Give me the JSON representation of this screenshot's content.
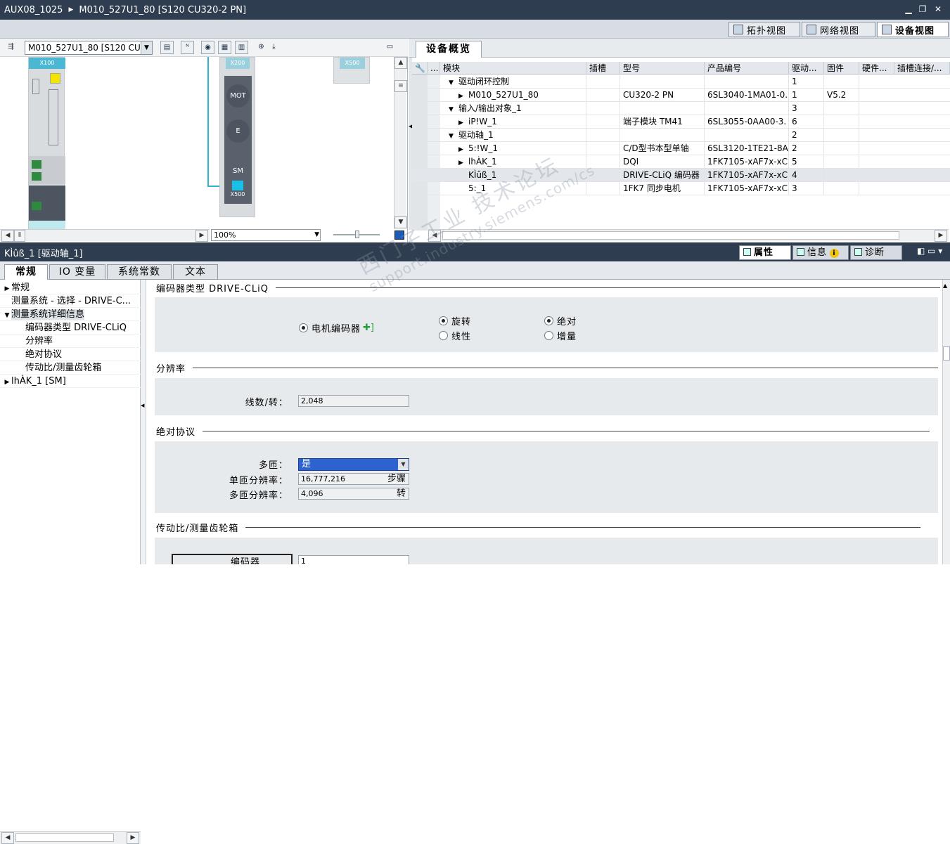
{
  "title": {
    "project": "AUX08_1025",
    "device": "M010_527U1_80 [S120 CU320-2 PN]",
    "win_min": "▁",
    "win_restore": "❐",
    "win_close": "✕"
  },
  "view_tabs": [
    {
      "label": "拓扑视图"
    },
    {
      "label": "网络视图"
    },
    {
      "label": "设备视图"
    }
  ],
  "device_view": {
    "device_select": "M010_527U1_80 [S120 CU",
    "zoom": "100%",
    "ports": {
      "x100": "X100",
      "x200": "X200",
      "x500a": "X500",
      "x500b": "X500"
    },
    "circles": {
      "mot": "MOT",
      "e": "E",
      "sm": "SM"
    }
  },
  "overview": {
    "tab": "设备概览",
    "headers": [
      "模块",
      "插槽",
      "型号",
      "产品编号",
      "驱动...",
      "固件",
      "硬件...",
      "插槽连接/..."
    ],
    "header_extra": "...",
    "rows": [
      {
        "expander": "▼",
        "module": "驱动闭环控制",
        "slot": "",
        "type": "",
        "order": "",
        "drive": "1",
        "fw": ""
      },
      {
        "expander": "▶",
        "module": "M010_527U1_80",
        "slot": "",
        "type": "CU320-2 PN",
        "order": "6SL3040-1MA01-0.",
        "drive": "1",
        "fw": "V5.2"
      },
      {
        "expander": "▼",
        "module": "输入/输出对象_1",
        "slot": "",
        "type": "",
        "order": "",
        "drive": "3",
        "fw": ""
      },
      {
        "expander": "▶",
        "module": "iP!W_1",
        "slot": "",
        "type": "端子模块 TM41",
        "order": "6SL3055-0AA00-3.",
        "drive": "6",
        "fw": ""
      },
      {
        "expander": "▼",
        "module": "驱动轴_1",
        "slot": "",
        "type": "",
        "order": "",
        "drive": "2",
        "fw": ""
      },
      {
        "expander": "▶",
        "module": "5:!W_1",
        "slot": "",
        "type": "C/D型书本型单轴",
        "order": "6SL3120-1TE21-8A",
        "drive": "2",
        "fw": ""
      },
      {
        "expander": "▶",
        "module": "lhÀK_1",
        "slot": "",
        "type": "DQI",
        "order": "1FK7105-xAF7x-xC.",
        "drive": "5",
        "fw": ""
      },
      {
        "expander": "",
        "module": "KÌûß_1",
        "slot": "",
        "type": "DRIVE-CLiQ 编码器",
        "order": "1FK7105-xAF7x-xC.",
        "drive": "4",
        "fw": ""
      },
      {
        "expander": "",
        "module": "5:_1",
        "slot": "",
        "type": "1FK7 同步电机",
        "order": "1FK7105-xAF7x-xC.",
        "drive": "3",
        "fw": ""
      }
    ]
  },
  "properties": {
    "title": "KÌûß_1 [驱动轴_1]",
    "tabs": {
      "properties": "属性",
      "info": "信息",
      "info_badge": "i",
      "diag": "诊断"
    },
    "subtabs": [
      "常规",
      "IO 变量",
      "系统常数",
      "文本"
    ],
    "nav": [
      {
        "expander": "▶",
        "label": "常规",
        "indent": 0
      },
      {
        "expander": "",
        "label": "测量系统 - 选择 - DRIVE-C...",
        "indent": 0
      },
      {
        "expander": "▼",
        "label": "测量系统详细信息",
        "indent": 0
      },
      {
        "expander": "",
        "label": "编码器类型 DRIVE-CLiQ",
        "indent": 1
      },
      {
        "expander": "",
        "label": "分辨率",
        "indent": 1
      },
      {
        "expander": "",
        "label": "绝对协议",
        "indent": 1
      },
      {
        "expander": "",
        "label": "传动比/测量齿轮箱",
        "indent": 1
      },
      {
        "expander": "▶",
        "label": "lhÀK_1 [SM]",
        "indent": 0
      }
    ],
    "encoder_type": {
      "heading": "编码器类型 DRIVE-CLiQ",
      "motor_encoder": "电机编码器",
      "rotary": "旋转",
      "linear": "线性",
      "absolute": "绝对",
      "incremental": "增量"
    },
    "resolution": {
      "heading": "分辨率",
      "lines_label": "线数/转：",
      "lines_value": "2,048"
    },
    "absolute_protocol": {
      "heading": "绝对协议",
      "multiturn_label": "多匝：",
      "multiturn_value": "是",
      "single_res_label": "单匝分辨率：",
      "single_res_value": "16,777,216",
      "single_res_unit": "步骤",
      "multi_res_label": "多匝分辨率：",
      "multi_res_value": "4,096",
      "multi_res_unit": "转"
    },
    "gear": {
      "heading": "传动比/测量齿轮箱",
      "encoder_label": "编码器",
      "encoder_value": "1"
    }
  },
  "watermark": {
    "line1": "西门子工业  技术论坛",
    "line2": "support.industry.siemens.com/cs"
  }
}
